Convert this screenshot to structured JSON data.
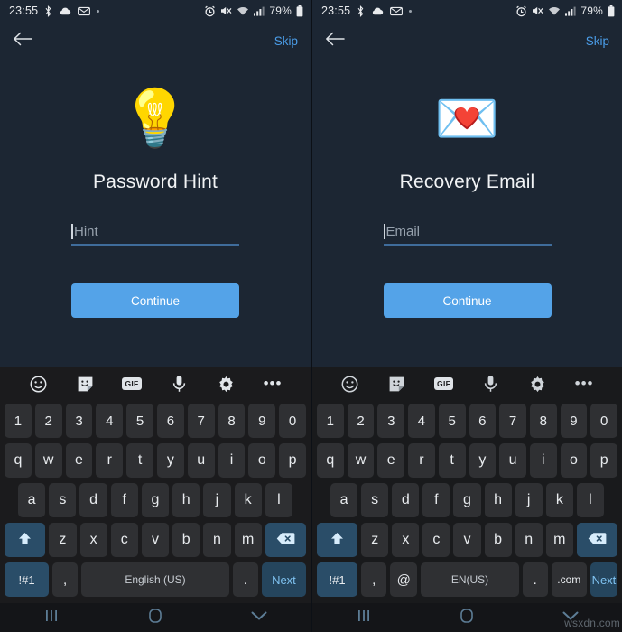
{
  "status_bar": {
    "time": "23:55",
    "left_icons": [
      "bluetooth-icon",
      "cloud-icon",
      "mail-icon",
      "dot-indicator"
    ],
    "right_icons": [
      "alarm-icon",
      "volume-muted-icon",
      "wifi-icon",
      "signal-icon"
    ],
    "battery_percent": "79%"
  },
  "panels": [
    {
      "id": "password-hint",
      "appbar": {
        "back": "back-arrow-icon",
        "skip_label": "Skip"
      },
      "hero_emoji": "💡",
      "hero_name": "light-bulb-icon",
      "title": "Password Hint",
      "input": {
        "placeholder": "Hint",
        "value": ""
      },
      "cta_label": "Continue",
      "keyboard": {
        "toolbar": [
          "emoji-icon",
          "sticker-icon",
          "gif-icon",
          "microphone-icon",
          "settings-gear-icon",
          "more-options-icon"
        ],
        "gif_label": "GIF",
        "row_numbers": [
          "1",
          "2",
          "3",
          "4",
          "5",
          "6",
          "7",
          "8",
          "9",
          "0"
        ],
        "row_top": [
          "q",
          "w",
          "e",
          "r",
          "t",
          "y",
          "u",
          "i",
          "o",
          "p"
        ],
        "row_home": [
          "a",
          "s",
          "d",
          "f",
          "g",
          "h",
          "j",
          "k",
          "l"
        ],
        "row_bottom": [
          "z",
          "x",
          "c",
          "v",
          "b",
          "n",
          "m"
        ],
        "shift_label": "⬆",
        "backspace_label": "⌫",
        "symbols_label": "!#1",
        "comma_label": ",",
        "space_label": "English (US)",
        "period_label": ".",
        "action_label": "Next"
      }
    },
    {
      "id": "recovery-email",
      "appbar": {
        "back": "back-arrow-icon",
        "skip_label": "Skip"
      },
      "hero_emoji": "💌",
      "hero_name": "love-letter-icon",
      "title": "Recovery Email",
      "input": {
        "placeholder": "Email",
        "value": ""
      },
      "cta_label": "Continue",
      "keyboard": {
        "toolbar": [
          "emoji-icon",
          "sticker-icon",
          "gif-icon",
          "microphone-icon",
          "settings-gear-icon",
          "more-options-icon"
        ],
        "gif_label": "GIF",
        "row_numbers": [
          "1",
          "2",
          "3",
          "4",
          "5",
          "6",
          "7",
          "8",
          "9",
          "0"
        ],
        "row_top": [
          "q",
          "w",
          "e",
          "r",
          "t",
          "y",
          "u",
          "i",
          "o",
          "p"
        ],
        "row_home": [
          "a",
          "s",
          "d",
          "f",
          "g",
          "h",
          "j",
          "k",
          "l"
        ],
        "row_bottom": [
          "z",
          "x",
          "c",
          "v",
          "b",
          "n",
          "m"
        ],
        "shift_label": "⬆",
        "backspace_label": "⌫",
        "symbols_label": "!#1",
        "comma_label": ",",
        "at_label": "@",
        "space_label": "EN(US)",
        "period_label": ".",
        "dotcom_label": ".com",
        "action_label": "Next"
      }
    }
  ],
  "navbar": {
    "recents": "recents-icon",
    "home": "home-icon",
    "dismiss": "hide-keyboard-chevron-icon"
  },
  "watermark": "wsxdn.com",
  "colors": {
    "background": "#1c2633",
    "accent_blue": "#54a3e8",
    "link_blue": "#4b9eea",
    "keyboard_bg": "#1b1b1d",
    "key_bg": "#2f3033",
    "key_accent": "#2a4d68"
  }
}
